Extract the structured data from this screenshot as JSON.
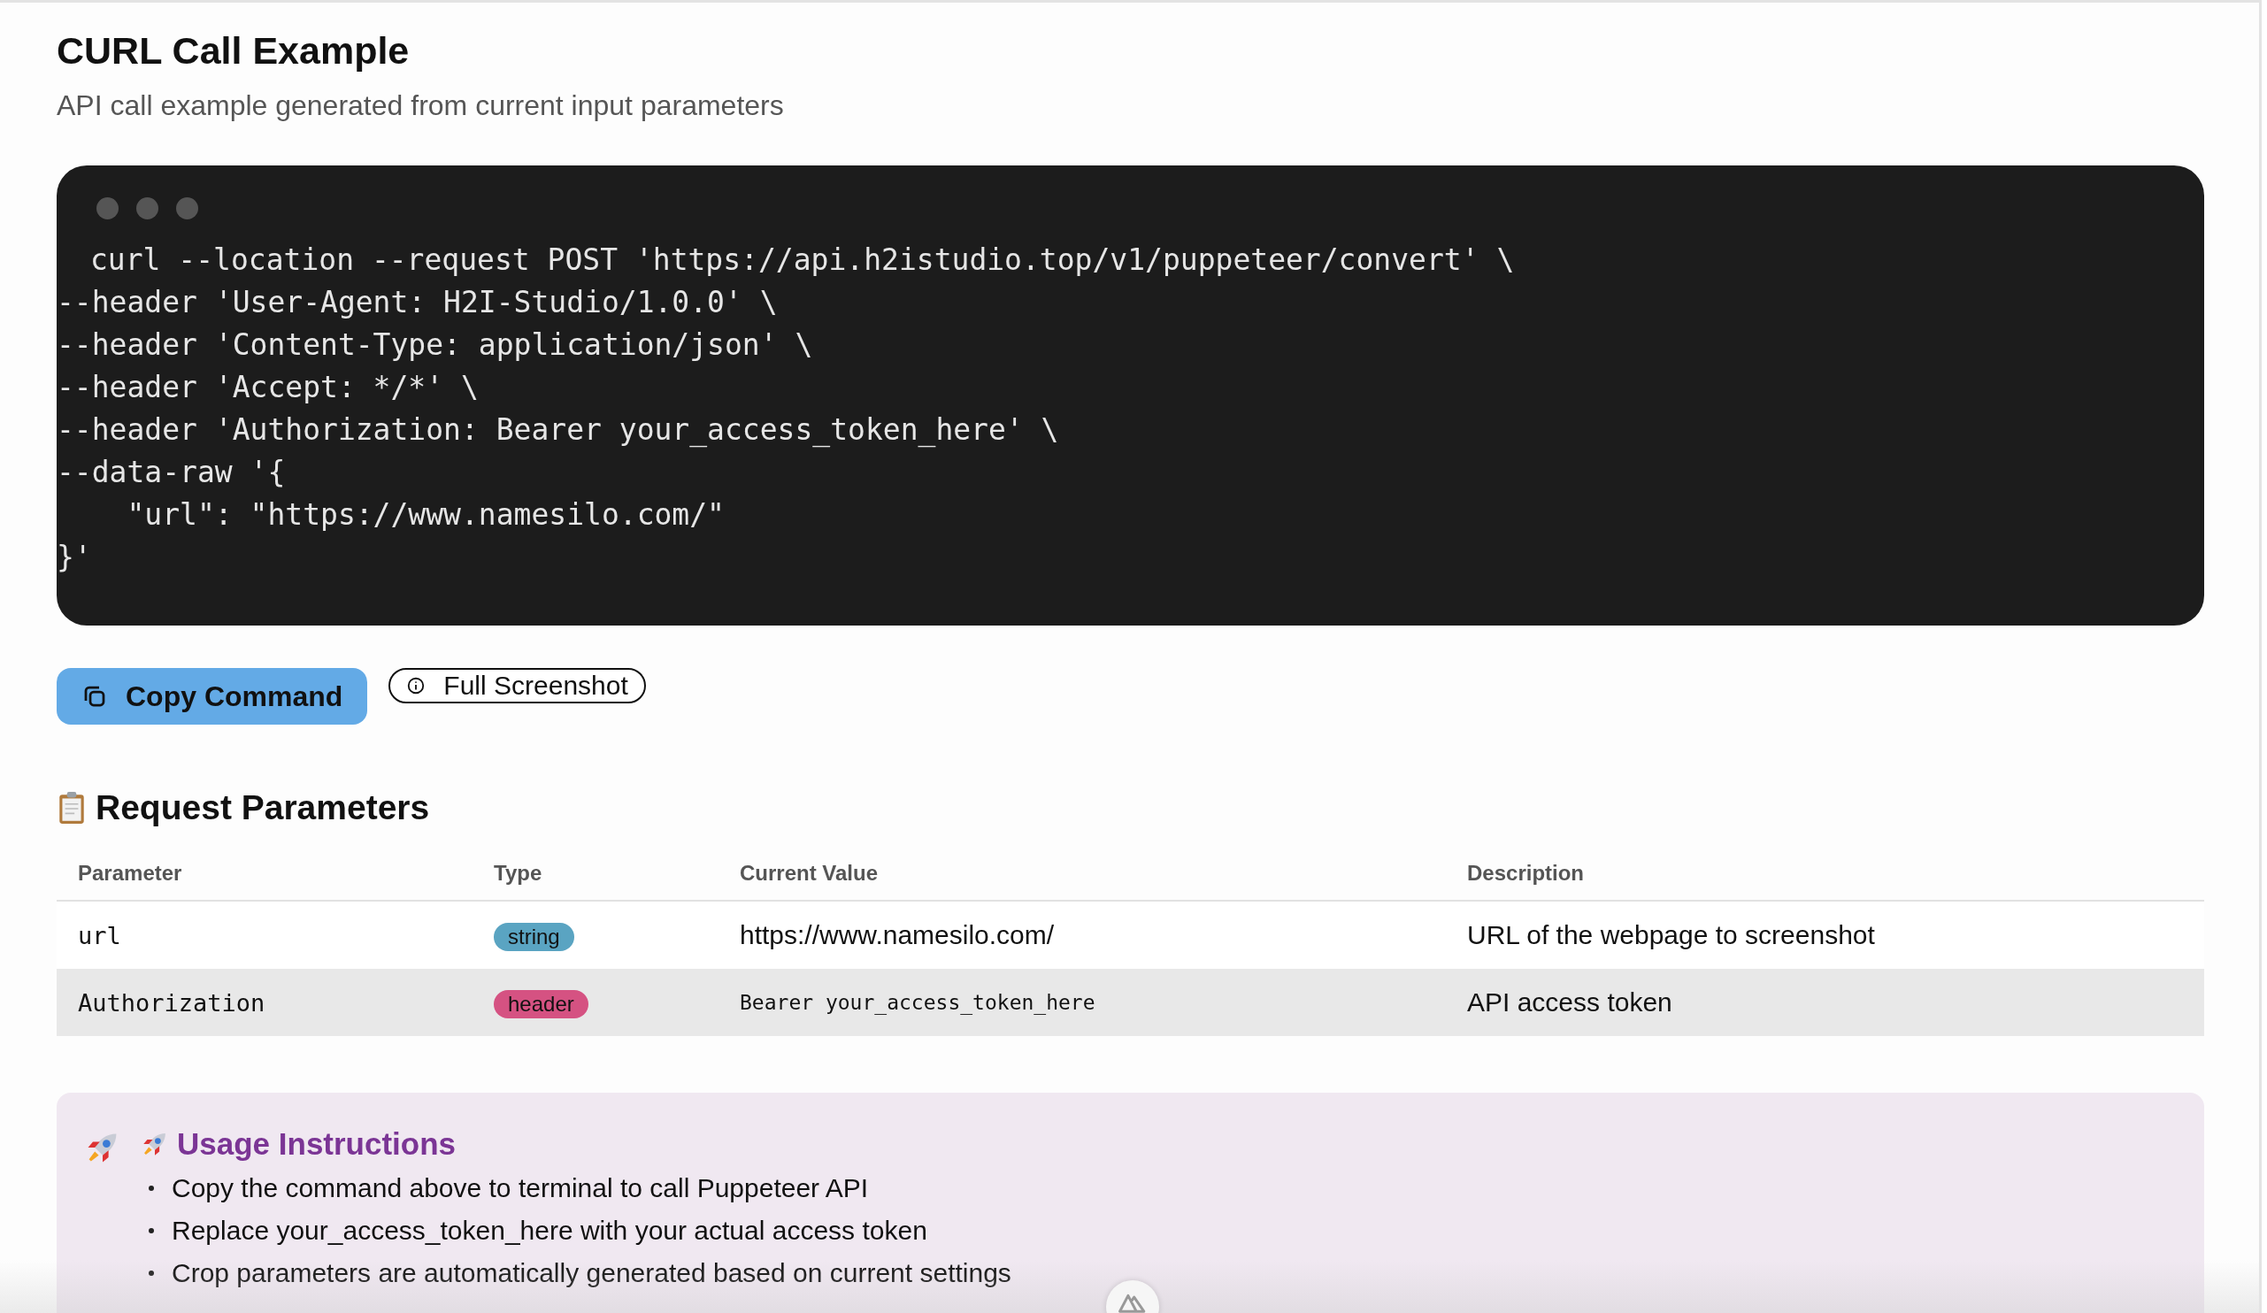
{
  "header": {
    "title": "CURL Call Example",
    "subtitle": "API call example generated from current input parameters"
  },
  "code_block": {
    "lines": [
      "curl --location --request POST 'https://api.h2istudio.top/v1/puppeteer/convert' \\",
      "--header 'User-Agent: H2I-Studio/1.0.0' \\",
      "--header 'Content-Type: application/json' \\",
      "--header 'Accept: */*' \\",
      "--header 'Authorization: Bearer your_access_token_here' \\",
      "--data-raw '{",
      "    \"url\": \"https://www.namesilo.com/\"",
      "}'"
    ]
  },
  "buttons": [
    {
      "label": "Copy Command",
      "kind": "primary"
    },
    {
      "label": "Full Screenshot",
      "kind": "outline"
    }
  ],
  "parameters": {
    "title": "Request Parameters",
    "columns": [
      "Parameter",
      "Type",
      "Current Value",
      "Description"
    ],
    "rows": [
      {
        "name": "url",
        "type": "string",
        "kind": "text",
        "color": "#5aa4c2",
        "value": "https://www.namesilo.com/",
        "description": "URL of the webpage to screenshot",
        "highlighted": false
      },
      {
        "name": "Authorization",
        "type": "header",
        "kind": "code",
        "color": "#d55282",
        "value": "Bearer your_access_token_here",
        "description": "API access token",
        "highlighted": true
      }
    ]
  },
  "usage": {
    "title": "Usage Instructions",
    "items": [
      "Copy the command above to terminal to call Puppeteer API",
      "Replace your_access_token_here with your actual access token",
      "Crop parameters are automatically generated based on current settings"
    ]
  }
}
